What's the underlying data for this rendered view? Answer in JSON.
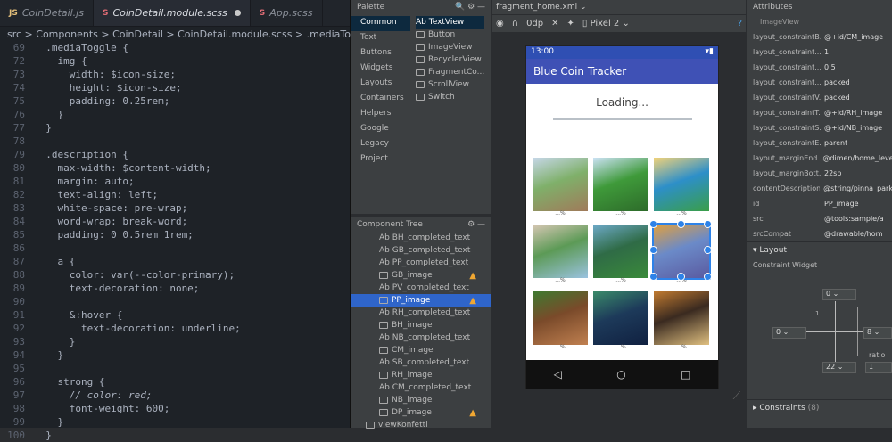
{
  "editor": {
    "tabs": [
      {
        "icon": "JS",
        "label": "CoinDetail.js"
      },
      {
        "icon": "S",
        "label": "CoinDetail.module.scss"
      },
      {
        "icon": "S",
        "label": "App.scss"
      }
    ],
    "breadcrumb": "src > Components > CoinDetail > CoinDetail.module.scss > .mediaToggle > img",
    "lines": [
      {
        "n": "69",
        "t": "  .mediaToggle {"
      },
      {
        "n": "72",
        "t": "    img {"
      },
      {
        "n": "73",
        "t": "      width: $icon-size;"
      },
      {
        "n": "74",
        "t": "      height: $icon-size;"
      },
      {
        "n": "75",
        "t": "      padding: 0.25rem;"
      },
      {
        "n": "76",
        "t": "    }"
      },
      {
        "n": "77",
        "t": "  }"
      },
      {
        "n": "78",
        "t": ""
      },
      {
        "n": "79",
        "t": "  .description {"
      },
      {
        "n": "80",
        "t": "    max-width: $content-width;"
      },
      {
        "n": "81",
        "t": "    margin: auto;"
      },
      {
        "n": "82",
        "t": "    text-align: left;"
      },
      {
        "n": "83",
        "t": "    white-space: pre-wrap;"
      },
      {
        "n": "84",
        "t": "    word-wrap: break-word;"
      },
      {
        "n": "85",
        "t": "    padding: 0 0.5rem 1rem;"
      },
      {
        "n": "86",
        "t": ""
      },
      {
        "n": "87",
        "t": "    a {"
      },
      {
        "n": "88",
        "t": "      color: var(--color-primary);"
      },
      {
        "n": "89",
        "t": "      text-decoration: none;"
      },
      {
        "n": "90",
        "t": ""
      },
      {
        "n": "91",
        "t": "      &:hover {"
      },
      {
        "n": "92",
        "t": "        text-decoration: underline;"
      },
      {
        "n": "93",
        "t": "      }"
      },
      {
        "n": "94",
        "t": "    }"
      },
      {
        "n": "95",
        "t": ""
      },
      {
        "n": "96",
        "t": "    strong {"
      },
      {
        "n": "97",
        "t": "      // color: red;"
      },
      {
        "n": "98",
        "t": "      font-weight: 600;"
      },
      {
        "n": "99",
        "t": "    }"
      },
      {
        "n": "100",
        "t": "  }"
      }
    ]
  },
  "palette": {
    "title": "Palette",
    "categories": [
      "Common",
      "Text",
      "Buttons",
      "Widgets",
      "Layouts",
      "Containers",
      "Helpers",
      "Google",
      "Legacy",
      "Project"
    ],
    "items": [
      "Ab TextView",
      "Button",
      "ImageView",
      "RecyclerView",
      "FragmentCo...",
      "ScrollView",
      "Switch"
    ]
  },
  "tree": {
    "title": "Component Tree",
    "rows": [
      {
        "label": "Ab BH_completed_text",
        "warn": false
      },
      {
        "label": "Ab GB_completed_text",
        "warn": false
      },
      {
        "label": "Ab PP_completed_text",
        "warn": false
      },
      {
        "label": "GB_image",
        "warn": true
      },
      {
        "label": "Ab PV_completed_text",
        "warn": false
      },
      {
        "label": "PP_image",
        "warn": true,
        "selected": true
      },
      {
        "label": "Ab RH_completed_text",
        "warn": false
      },
      {
        "label": "BH_image",
        "warn": false
      },
      {
        "label": "Ab NB_completed_text",
        "warn": false
      },
      {
        "label": "CM_image",
        "warn": false
      },
      {
        "label": "Ab SB_completed_text",
        "warn": false
      },
      {
        "label": "RH_image",
        "warn": false
      },
      {
        "label": "Ab CM_completed_text",
        "warn": false
      },
      {
        "label": "NB_image",
        "warn": false
      },
      {
        "label": "DP_image",
        "warn": true
      },
      {
        "label": "viewKonfetti",
        "warn": false
      }
    ]
  },
  "designer": {
    "file_tab": "fragment_home.xml",
    "device": "Pixel 2",
    "phone": {
      "time": "13:00",
      "app_title": "Blue Coin Tracker",
      "loading": "Loading...",
      "captions": [
        "...%",
        "...%",
        "...%",
        "...%",
        "...%",
        "...%",
        "...%",
        "...%",
        "...%"
      ]
    }
  },
  "attributes": {
    "title": "Attributes",
    "component": "ImageView",
    "rows": [
      {
        "k": "layout_constraintB...",
        "v": "@+id/CM_image"
      },
      {
        "k": "layout_constraint...",
        "v": "1"
      },
      {
        "k": "layout_constraint...",
        "v": "0.5"
      },
      {
        "k": "layout_constraint...",
        "v": "packed"
      },
      {
        "k": "layout_constraintV...",
        "v": "packed"
      },
      {
        "k": "layout_constraintT...",
        "v": "@+id/RH_image"
      },
      {
        "k": "layout_constraintS...",
        "v": "@+id/NB_image"
      },
      {
        "k": "layout_constraintE...",
        "v": "parent"
      },
      {
        "k": "layout_marginEnd",
        "v": "@dimen/home_leve"
      },
      {
        "k": "layout_marginBott...",
        "v": "22sp"
      },
      {
        "k": "contentDescription",
        "v": "@string/pinna_park"
      },
      {
        "k": "id",
        "v": "PP_image"
      },
      {
        "k": "src",
        "v": "@tools:sample/a"
      },
      {
        "k": "srcCompat",
        "v": "@drawable/hom"
      }
    ],
    "layout_section": "Layout",
    "constraint_widget": "Constraint Widget",
    "cw_top": "0",
    "cw_left": "0",
    "cw_right": "8",
    "cw_bottom": "22",
    "cw_side": "1",
    "ratio_label": "ratio",
    "ratio_value": "1",
    "constraints_section": "Constraints",
    "constraints_count": "(8)"
  }
}
